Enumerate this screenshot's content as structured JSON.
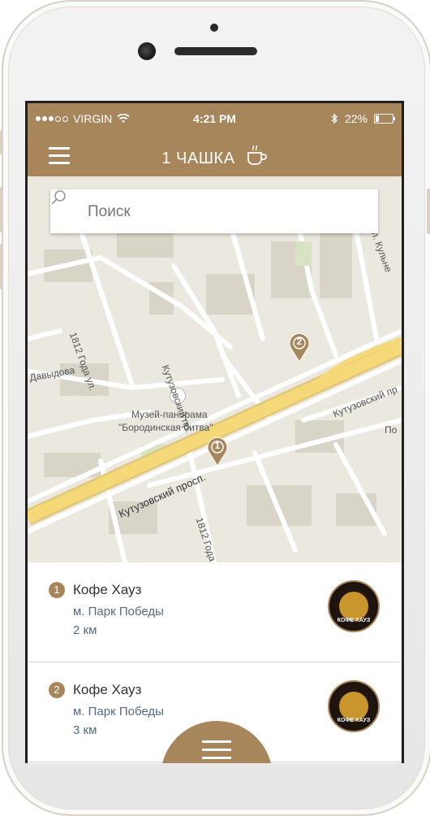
{
  "status_bar": {
    "carrier": "VIRGIN",
    "time": "4:21 PM",
    "battery": "22%",
    "battery_level": 0.22
  },
  "nav": {
    "title": "1 ЧАШКА",
    "menu_icon": "hamburger-icon",
    "title_icon": "coffee-cup-icon"
  },
  "search": {
    "placeholder": "Поиск",
    "value": ""
  },
  "map": {
    "labels": {
      "museum_line1": "Музей-панорама",
      "museum_line2": "\"Бородинская битва\"",
      "kutuzovsky_pr_top": "Кутузовский пр.",
      "kutuzovsky_pr_right": "Кутузовский пр",
      "kutuzovsky_prosp": "Кутузовский просп.",
      "street_1812_left": "1812 Года ул.",
      "street_1812_bottom": "1812 Года",
      "davydova": "Давыдова",
      "kulneva": "ул. Кульне",
      "po": "По"
    },
    "pins": [
      {
        "number": "1"
      },
      {
        "number": "2"
      }
    ]
  },
  "cafes": [
    {
      "number": "1",
      "name": "Кофе Хауз",
      "metro": "м. Парк Победы",
      "distance": "2 км",
      "logo_text": "КОФЕ ХАУЗ"
    },
    {
      "number": "2",
      "name": "Кофе Хауз",
      "metro": "м. Парк Победы",
      "distance": "3 км",
      "logo_text": "КОФЕ ХАУЗ"
    }
  ],
  "colors": {
    "brand": "#a8865b",
    "metro_text": "#566a80"
  }
}
